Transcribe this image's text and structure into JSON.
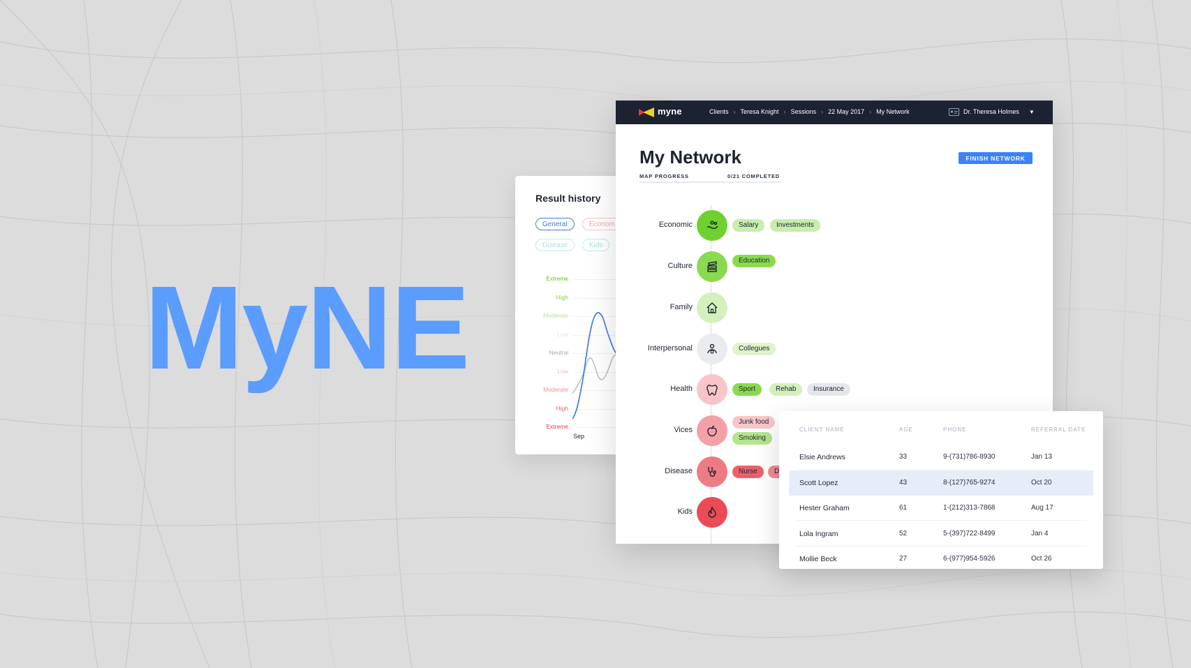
{
  "hero": {
    "text": "MyNE",
    "color": "#5b9cff"
  },
  "history": {
    "title": "Result history",
    "filters": [
      {
        "label": "General",
        "color": "#3b7fd9",
        "active": true
      },
      {
        "label": "Econom",
        "color": "#f2a5ad",
        "active": false
      },
      {
        "label": "Disease",
        "color": "#a9e2e0",
        "active": false
      },
      {
        "label": "Kids",
        "color": "#a9e2e0",
        "active": false
      }
    ],
    "levels": [
      {
        "label": "Extreme",
        "color": "#5cc61b"
      },
      {
        "label": "High",
        "color": "#7fcf48"
      },
      {
        "label": "Moderate",
        "color": "#b7e08f"
      },
      {
        "label": "Low",
        "color": "#d9efbf"
      },
      {
        "label": "Neutral",
        "color": "#a5a9b2"
      },
      {
        "label": "Low",
        "color": "#f2b6bb"
      },
      {
        "label": "Moderate",
        "color": "#ee8d95"
      },
      {
        "label": "High",
        "color": "#eb5d69"
      },
      {
        "label": "Extreme",
        "color": "#e63946"
      }
    ],
    "x_label": "Sep"
  },
  "topbar": {
    "logo": "myne",
    "breadcrumbs": [
      "Clients",
      "Teresa Knight",
      "Sessions",
      "22 May 2017",
      "My Network"
    ],
    "user": "Dr. Theresa Holmes"
  },
  "network": {
    "title": "My Network",
    "finish_button": "FINISH NETWORK",
    "progress_label": "MAP PROGRESS",
    "progress_value": "0/21 COMPLETED",
    "progress_fraction": 0,
    "categories": [
      {
        "label": "Economic",
        "icon": "hand-coins-icon",
        "circle": "#6fd12e",
        "icon_color": "#1d2330",
        "tags": [
          {
            "label": "Salary",
            "bg": "#c8edae"
          },
          {
            "label": "Investments",
            "bg": "#c8edae"
          }
        ]
      },
      {
        "label": "Culture",
        "icon": "books-icon",
        "circle": "#8ada4f",
        "icon_color": "#1d2330",
        "tags": [
          {
            "label": "Education",
            "bg": "#8ada4f"
          }
        ]
      },
      {
        "label": "Family",
        "icon": "house-icon",
        "circle": "#d4f0bd",
        "icon_color": "#1d2330",
        "tags": []
      },
      {
        "label": "Interpersonal",
        "icon": "people-icon",
        "circle": "#e9ebee",
        "icon_color": "#1d2330",
        "tags": [
          {
            "label": "Collegues",
            "bg": "#dff3cc"
          }
        ]
      },
      {
        "label": "Health",
        "icon": "tooth-icon",
        "circle": "#f8c6ca",
        "icon_color": "#1d2330",
        "tags": [
          {
            "label": "Sport",
            "bg": "#8ada4f"
          },
          {
            "label": "Rehab",
            "bg": "#d4f0bd"
          },
          {
            "label": "Insurance",
            "bg": "#e5e7ea"
          }
        ]
      },
      {
        "label": "Vices",
        "icon": "apple-icon",
        "circle": "#f3a0a7",
        "icon_color": "#1d2330",
        "tags": [
          {
            "label": "Junk food",
            "bg": "#f8c6ca"
          },
          {
            "label": "Smoking",
            "bg": "#b4e58e"
          }
        ]
      },
      {
        "label": "Disease",
        "icon": "stethoscope-icon",
        "circle": "#ee7a83",
        "icon_color": "#1d2330",
        "tags": [
          {
            "label": "Nurse",
            "bg": "#ee5f6b"
          },
          {
            "label": "D",
            "bg": "#f08a92"
          }
        ]
      },
      {
        "label": "Kids",
        "icon": "flame-icon",
        "circle": "#eb4b57",
        "icon_color": "#1d2330",
        "tags": []
      }
    ]
  },
  "clients": {
    "headers": [
      "CLIENT NAME",
      "AGE",
      "PHONE",
      "REFERRAL DATE"
    ],
    "rows": [
      {
        "name": "Elsie Andrews",
        "age": "33",
        "phone": "9-(731)786-8930",
        "date": "Jan 13",
        "selected": false
      },
      {
        "name": "Scott Lopez",
        "age": "43",
        "phone": "8-(127)765-9274",
        "date": "Oct 20",
        "selected": true
      },
      {
        "name": "Hester Graham",
        "age": "61",
        "phone": "1-(212)313-7868",
        "date": "Aug 17",
        "selected": false
      },
      {
        "name": "Lola Ingram",
        "age": "52",
        "phone": "5-(397)722-8499",
        "date": "Jan 4",
        "selected": false
      },
      {
        "name": "Mollie Beck",
        "age": "27",
        "phone": "6-(977)954-5926",
        "date": "Oct 26",
        "selected": false
      }
    ]
  }
}
